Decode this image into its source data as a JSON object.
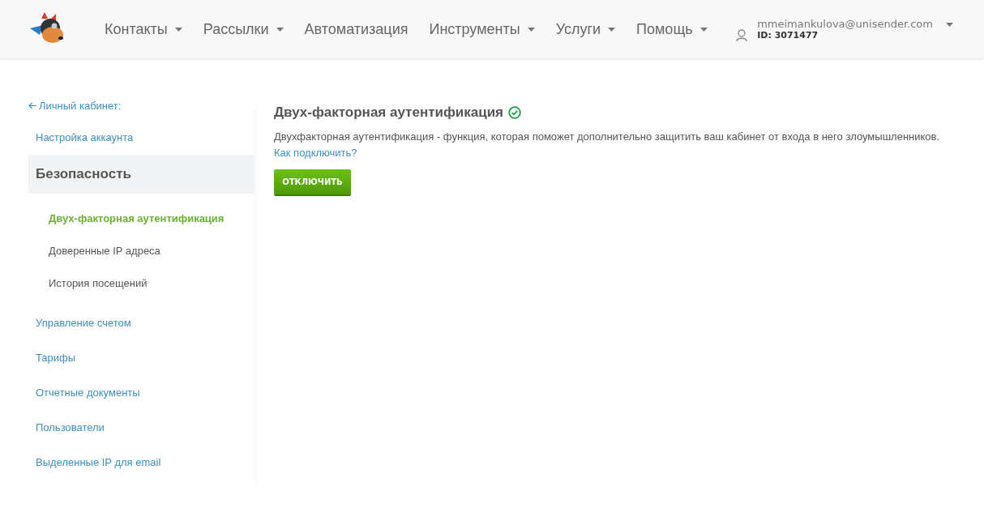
{
  "header": {
    "nav": [
      {
        "label": "Контакты",
        "dropdown": true
      },
      {
        "label": "Рассылки",
        "dropdown": true
      },
      {
        "label": "Автоматизация",
        "dropdown": false
      },
      {
        "label": "Инструменты",
        "dropdown": true
      },
      {
        "label": "Услуги",
        "dropdown": true
      },
      {
        "label": "Помощь",
        "dropdown": true
      }
    ],
    "account": {
      "email": "mmeimankulova@unisender.com",
      "id": "ID: 3071477"
    }
  },
  "sidebar": {
    "back": "Личный кабинет:",
    "items": [
      {
        "kind": "link",
        "label": "Настройка аккаунта"
      },
      {
        "kind": "section",
        "label": "Безопасность",
        "children": [
          {
            "label": "Двух-факторная аутентификация",
            "selected": true
          },
          {
            "label": "Доверенные IP адреса",
            "selected": false
          },
          {
            "label": "История посещений",
            "selected": false
          }
        ]
      },
      {
        "kind": "link",
        "label": "Управление счетом"
      },
      {
        "kind": "link",
        "label": "Тарифы"
      },
      {
        "kind": "link",
        "label": "Отчетные документы"
      },
      {
        "kind": "link",
        "label": "Пользователи"
      },
      {
        "kind": "link",
        "label": "Выделенные IP для email"
      }
    ]
  },
  "content": {
    "title": "Двух-факторная аутентификация",
    "enabled": true,
    "description": "Двухфакторная аутентификация - функция, которая поможет дополнительно защитить ваш кабинет от входа в него злоумышленников.",
    "help_link": "Как подключить?",
    "button": "ОТКЛЮЧИТЬ"
  }
}
